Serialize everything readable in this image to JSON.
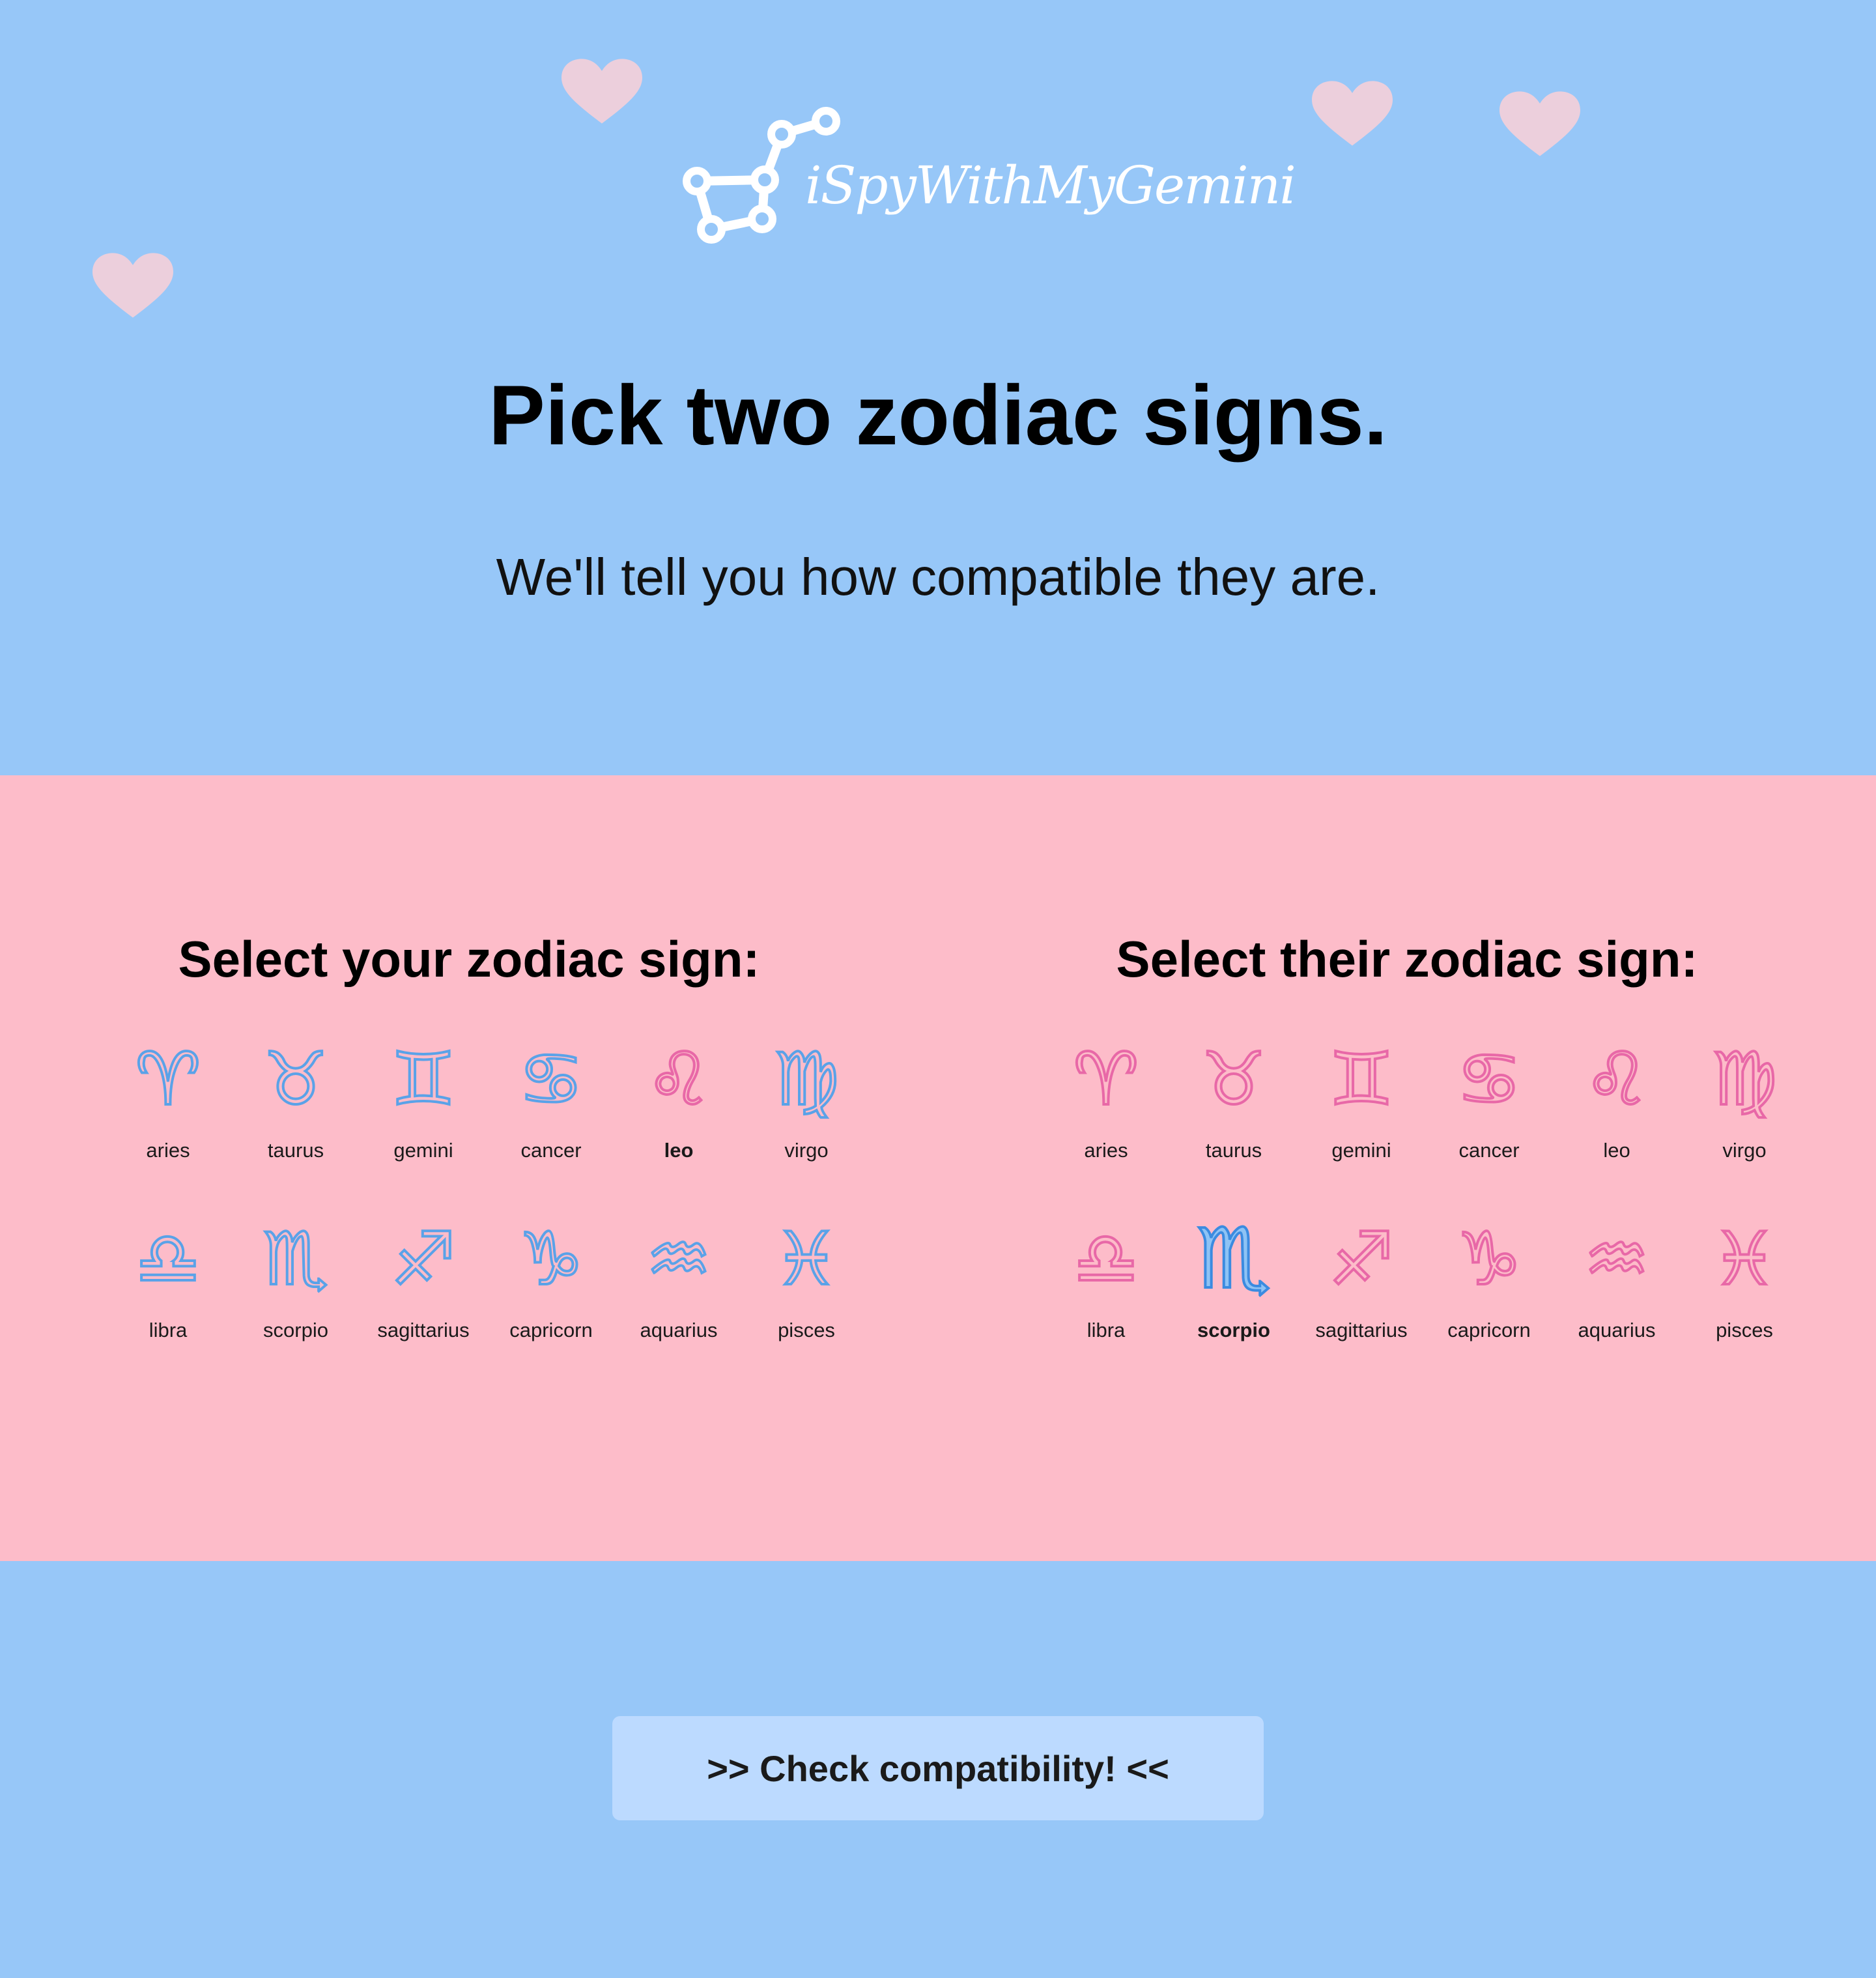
{
  "brand": {
    "name": "iSpyWithMyGemini",
    "logo_icon": "constellation-icon"
  },
  "hero": {
    "title": "Pick two zodiac signs.",
    "subtitle": "We'll tell you how compatible they are."
  },
  "colors": {
    "sky": "#97c7f8",
    "pink_band": "#fdbcc9",
    "blue_glyph": "#5aa2e8",
    "pink_glyph": "#e868a7",
    "heart": "#eccfdc",
    "button": "#bcdaff"
  },
  "your_picker": {
    "heading": "Select your zodiac sign:",
    "selected": "leo",
    "signs": [
      {
        "label": "aries",
        "glyph": "♈"
      },
      {
        "label": "taurus",
        "glyph": "♉"
      },
      {
        "label": "gemini",
        "glyph": "♊"
      },
      {
        "label": "cancer",
        "glyph": "♋"
      },
      {
        "label": "leo",
        "glyph": "♌"
      },
      {
        "label": "virgo",
        "glyph": "♍"
      },
      {
        "label": "libra",
        "glyph": "♎"
      },
      {
        "label": "scorpio",
        "glyph": "♏"
      },
      {
        "label": "sagittarius",
        "glyph": "♐"
      },
      {
        "label": "capricorn",
        "glyph": "♑"
      },
      {
        "label": "aquarius",
        "glyph": "♒"
      },
      {
        "label": "pisces",
        "glyph": "♓"
      }
    ]
  },
  "their_picker": {
    "heading": "Select their zodiac sign:",
    "selected": "scorpio",
    "signs": [
      {
        "label": "aries",
        "glyph": "♈"
      },
      {
        "label": "taurus",
        "glyph": "♉"
      },
      {
        "label": "gemini",
        "glyph": "♊"
      },
      {
        "label": "cancer",
        "glyph": "♋"
      },
      {
        "label": "leo",
        "glyph": "♌"
      },
      {
        "label": "virgo",
        "glyph": "♍"
      },
      {
        "label": "libra",
        "glyph": "♎"
      },
      {
        "label": "scorpio",
        "glyph": "♏"
      },
      {
        "label": "sagittarius",
        "glyph": "♐"
      },
      {
        "label": "capricorn",
        "glyph": "♑"
      },
      {
        "label": "aquarius",
        "glyph": "♒"
      },
      {
        "label": "pisces",
        "glyph": "♓"
      }
    ]
  },
  "cta": {
    "label": ">> Check compatibility! <<"
  }
}
